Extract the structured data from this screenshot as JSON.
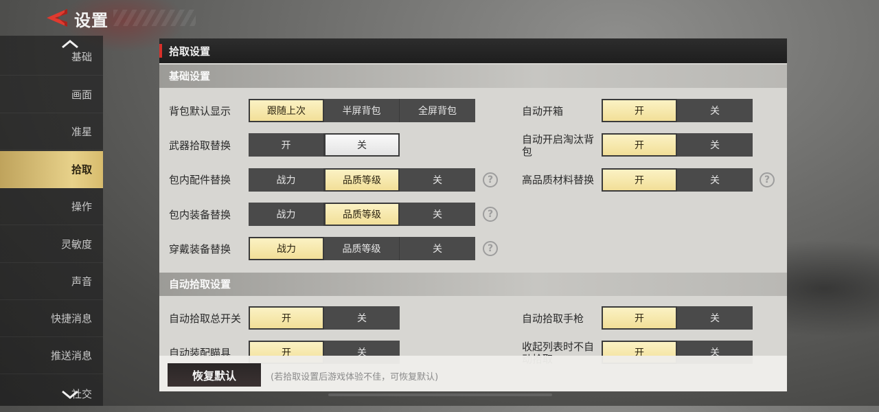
{
  "header": {
    "title": "设置"
  },
  "sidebar": {
    "items": [
      {
        "label": "基础"
      },
      {
        "label": "画面"
      },
      {
        "label": "准星"
      },
      {
        "label": "拾取"
      },
      {
        "label": "操作"
      },
      {
        "label": "灵敏度"
      },
      {
        "label": "声音"
      },
      {
        "label": "快捷消息"
      },
      {
        "label": "推送消息"
      },
      {
        "label": "社交"
      }
    ],
    "active_index": 3
  },
  "panel": {
    "title": "拾取设置",
    "basic_section": "基础设置",
    "auto_section": "自动拾取设置",
    "rows": {
      "bag_default": {
        "label": "背包默认显示",
        "options": [
          "跟随上次",
          "半屏背包",
          "全屏背包"
        ],
        "selected": 0
      },
      "weapon_replace": {
        "label": "武器拾取替换",
        "options": [
          "开",
          "关"
        ],
        "selected": 1
      },
      "attach_replace": {
        "label": "包内配件替换",
        "options": [
          "战力",
          "品质等级",
          "关"
        ],
        "selected": 1
      },
      "equip_replace": {
        "label": "包内装备替换",
        "options": [
          "战力",
          "品质等级",
          "关"
        ],
        "selected": 1
      },
      "wear_replace": {
        "label": "穿戴装备替换",
        "options": [
          "战力",
          "品质等级",
          "关"
        ],
        "selected": 0
      },
      "auto_open_box": {
        "label": "自动开箱",
        "options": [
          "开",
          "关"
        ],
        "selected": 0
      },
      "auto_open_eliminated": {
        "label": "自动开启淘汰背包",
        "options": [
          "开",
          "关"
        ],
        "selected": 0
      },
      "hq_material": {
        "label": "高品质材料替换",
        "options": [
          "开",
          "关"
        ],
        "selected": 0
      },
      "auto_pick_master": {
        "label": "自动拾取总开关",
        "options": [
          "开",
          "关"
        ],
        "selected": 0
      },
      "auto_equip_scope": {
        "label": "自动装配瞄具",
        "options": [
          "开",
          "关"
        ],
        "selected": 0
      },
      "auto_pick_pistol": {
        "label": "自动拾取手枪",
        "options": [
          "开",
          "关"
        ],
        "selected": 0
      },
      "collapse_list": {
        "label": "收起列表时不自动拾取",
        "options": [
          "开",
          "关"
        ],
        "selected": 0
      }
    },
    "help_glyph": "?",
    "reset_label": "恢复默认",
    "reset_hint": "(若拾取设置后游戏体验不佳，可恢复默认)"
  },
  "icons": {
    "back": "back-arrow-icon",
    "help": "question-icon",
    "up": "chevron-up-icon",
    "down": "chevron-down-icon"
  },
  "colors": {
    "accent_red": "#d8302a",
    "selected_gold": "#f2df98",
    "sidebar_active": "#e7d18a"
  }
}
